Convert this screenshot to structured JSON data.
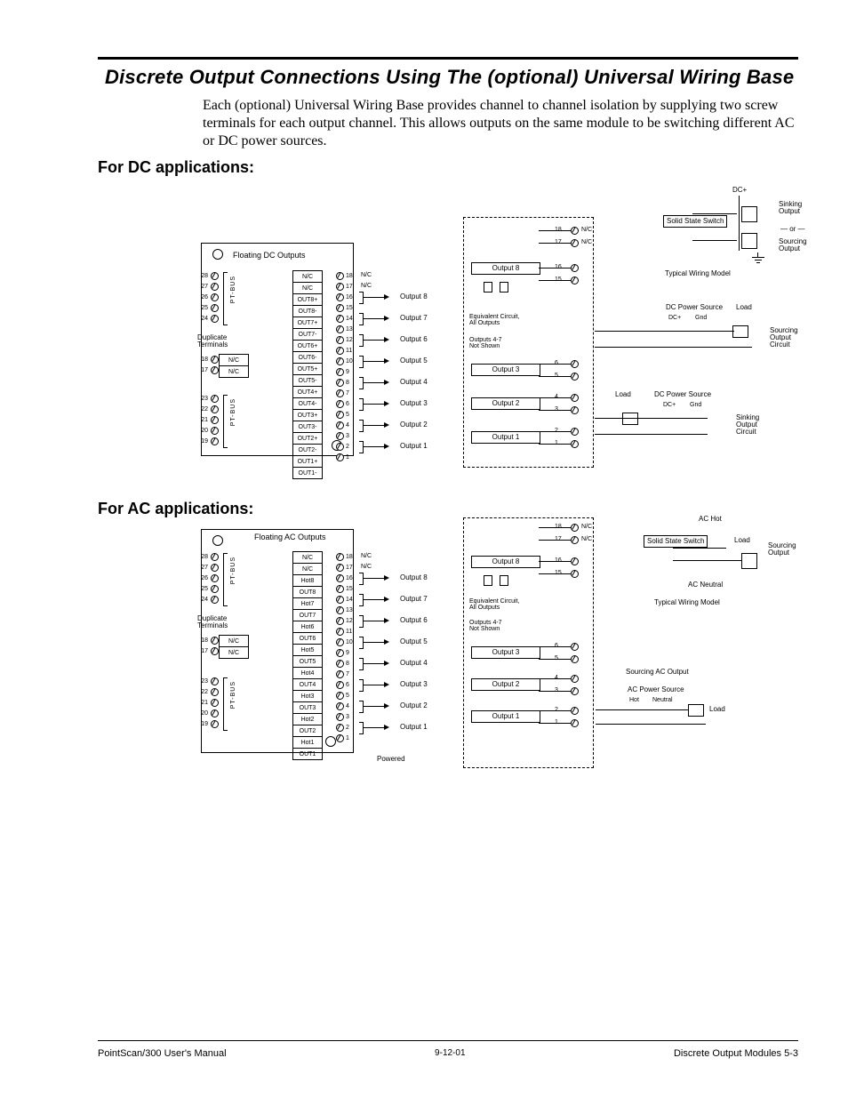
{
  "title": "Discrete Output Connections Using The (optional) Universal Wiring Base",
  "intro": "Each (optional) Universal Wiring Base provides channel to channel isolation by supplying two screw terminals for each output channel. This allows outputs on the same module to be switching different AC or DC power sources.",
  "sec_dc": "For DC applications:",
  "sec_ac": "For AC applications:",
  "dc_diagram": {
    "left_title": "Floating DC Outputs",
    "left_terms_top": [
      "28",
      "27",
      "26",
      "25",
      "24"
    ],
    "left_terms_bot": [
      "23",
      "22",
      "21",
      "20",
      "19"
    ],
    "ptbus": "PT-BUS",
    "dup": "Duplicate\nTerminals",
    "dup_rows": [
      {
        "n": "18",
        "t": "N/C"
      },
      {
        "n": "17",
        "t": "N/C"
      }
    ],
    "right_rows": [
      {
        "t": "N/C",
        "n": "18",
        "note": "N/C"
      },
      {
        "t": "N/C",
        "n": "17",
        "note": "N/C"
      },
      {
        "t": "OUT8+",
        "n": "16"
      },
      {
        "t": "OUT8-",
        "n": "15"
      },
      {
        "t": "OUT7+",
        "n": "14"
      },
      {
        "t": "OUT7-",
        "n": "13"
      },
      {
        "t": "OUT6+",
        "n": "12"
      },
      {
        "t": "OUT6-",
        "n": "11"
      },
      {
        "t": "OUT5+",
        "n": "10"
      },
      {
        "t": "OUT5-",
        "n": "9"
      },
      {
        "t": "OUT4+",
        "n": "8"
      },
      {
        "t": "OUT4-",
        "n": "7"
      },
      {
        "t": "OUT3+",
        "n": "6"
      },
      {
        "t": "OUT3-",
        "n": "5"
      },
      {
        "t": "OUT2+",
        "n": "4"
      },
      {
        "t": "OUT2-",
        "n": "3"
      },
      {
        "t": "OUT1+",
        "n": "2"
      },
      {
        "t": "OUT1-",
        "n": "1"
      }
    ],
    "out_labels": [
      "Output 8",
      "Output 7",
      "Output 6",
      "Output 5",
      "Output 4",
      "Output 3",
      "Output 2",
      "Output 1"
    ],
    "middle": {
      "eq": "Equivalent Circuit,\nAll Outputs",
      "notshown": "Outputs 4-7\nNot Shown",
      "out8": "Output 8",
      "out3": "Output 3",
      "out2": "Output 2",
      "out1": "Output 1",
      "terms": [
        {
          "n": "18",
          "t": "N/C"
        },
        {
          "n": "17",
          "t": "N/C"
        },
        {
          "n": "16",
          "t": ""
        },
        {
          "n": "15",
          "t": ""
        },
        {
          "n": "6",
          "t": ""
        },
        {
          "n": "5",
          "t": ""
        },
        {
          "n": "4",
          "t": ""
        },
        {
          "n": "3",
          "t": ""
        },
        {
          "n": "2",
          "t": ""
        },
        {
          "n": "1",
          "t": ""
        }
      ]
    },
    "right": {
      "dcplus": "DC+",
      "sss": "Solid\nState\nSwitch",
      "sink": "Sinking\nOutput",
      "src": "Sourcing\nOutput",
      "or": "— or —",
      "twm": "Typical Wiring Model",
      "dcps": "DC Power Source",
      "load": "Load",
      "dcplus2": "DC+",
      "gnd": "Gnd",
      "src_circ": "Sourcing\nOutput\nCircuit",
      "sink_circ": "Sinking\nOutput\nCircuit"
    }
  },
  "ac_diagram": {
    "left_title": "Floating AC Outputs",
    "right_rows": [
      {
        "t": "N/C",
        "n": "18",
        "note": "N/C"
      },
      {
        "t": "N/C",
        "n": "17",
        "note": "N/C"
      },
      {
        "t": "Hot8",
        "n": "16"
      },
      {
        "t": "OUT8",
        "n": "15"
      },
      {
        "t": "Hot7",
        "n": "14"
      },
      {
        "t": "OUT7",
        "n": "13"
      },
      {
        "t": "Hot6",
        "n": "12"
      },
      {
        "t": "OUT6",
        "n": "11"
      },
      {
        "t": "Hot5",
        "n": "10"
      },
      {
        "t": "OUT5",
        "n": "9"
      },
      {
        "t": "Hot4",
        "n": "8"
      },
      {
        "t": "OUT4",
        "n": "7"
      },
      {
        "t": "Hot3",
        "n": "6"
      },
      {
        "t": "OUT3",
        "n": "5"
      },
      {
        "t": "Hot2",
        "n": "4"
      },
      {
        "t": "OUT2",
        "n": "3"
      },
      {
        "t": "Hot1",
        "n": "2"
      },
      {
        "t": "OUT1",
        "n": "1"
      }
    ],
    "out_labels": [
      "Output 8",
      "Output 7",
      "Output 6",
      "Output 5",
      "Output 4",
      "Output 3",
      "Output 2",
      "Output 1"
    ],
    "powered": "Powered",
    "middle": {
      "eq": "Equivalent Circuit,\nAll Outputs",
      "notshown": "Outputs 4-7\nNot Shown",
      "out8": "Output 8",
      "out3": "Output 3",
      "out2": "Output 2",
      "out1": "Output 1",
      "terms": [
        {
          "n": "18",
          "t": "N/C"
        },
        {
          "n": "17",
          "t": "N/C"
        },
        {
          "n": "16",
          "t": ""
        },
        {
          "n": "15",
          "t": ""
        },
        {
          "n": "6",
          "t": ""
        },
        {
          "n": "5",
          "t": ""
        },
        {
          "n": "4",
          "t": ""
        },
        {
          "n": "3",
          "t": ""
        },
        {
          "n": "2",
          "t": ""
        },
        {
          "n": "1",
          "t": ""
        }
      ]
    },
    "right": {
      "achot": "AC Hot",
      "sss": "Solid\nState\nSwitch",
      "load": "Load",
      "src": "Sourcing\nOutput",
      "acneutral": "AC Neutral",
      "twm": "Typical Wiring Model",
      "srcac": "Sourcing AC Output",
      "acps": "AC Power Source",
      "hot": "Hot",
      "neutral": "Neutral"
    }
  },
  "footer": {
    "left": "PointScan/300 User's Manual",
    "mid": "9-12-01",
    "right": "Discrete Output Modules   5-3"
  }
}
